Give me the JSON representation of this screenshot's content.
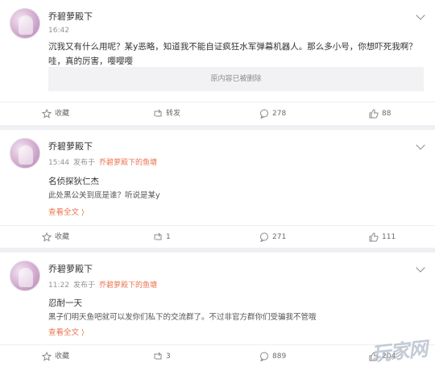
{
  "posts": [
    {
      "username": "乔碧萝殿下",
      "time": "16:42",
      "content": [
        "沉我又有什么用呢？某y恶略，知道我不能自证疯狂水军弹幕机器人。那么多小号，你想吓死我啊？",
        "哇，真的厉害，嘤嘤嘤"
      ],
      "deleted_notice": "原内容已被删除",
      "actions": {
        "favorite": "收藏",
        "repost": "转发",
        "comment": "278",
        "like": "88"
      }
    },
    {
      "username": "乔碧萝殿下",
      "time": "15:44",
      "from_prefix": "发布于",
      "source": "乔碧萝殿下的鱼塘",
      "content": [
        "名侦探狄仁杰",
        "此处黑公关到底是谁？听说是某y"
      ],
      "more": "查看全文 ⟩",
      "actions": {
        "favorite": "收藏",
        "repost": "1",
        "comment": "271",
        "like": "111"
      }
    },
    {
      "username": "乔碧萝殿下",
      "time": "11:22",
      "from_prefix": "发布于",
      "source": "乔碧萝殿下的鱼塘",
      "content": [
        "忍耐一天",
        "黑子们明天鱼吧就可以发你们私下的交流群了。不过非官方群你们受骗我不管哦"
      ],
      "more": "查看全文 ⟩",
      "actions": {
        "favorite": "收藏",
        "repost": "3",
        "comment": "889",
        "like": "204"
      }
    }
  ],
  "watermark": "玩家网"
}
